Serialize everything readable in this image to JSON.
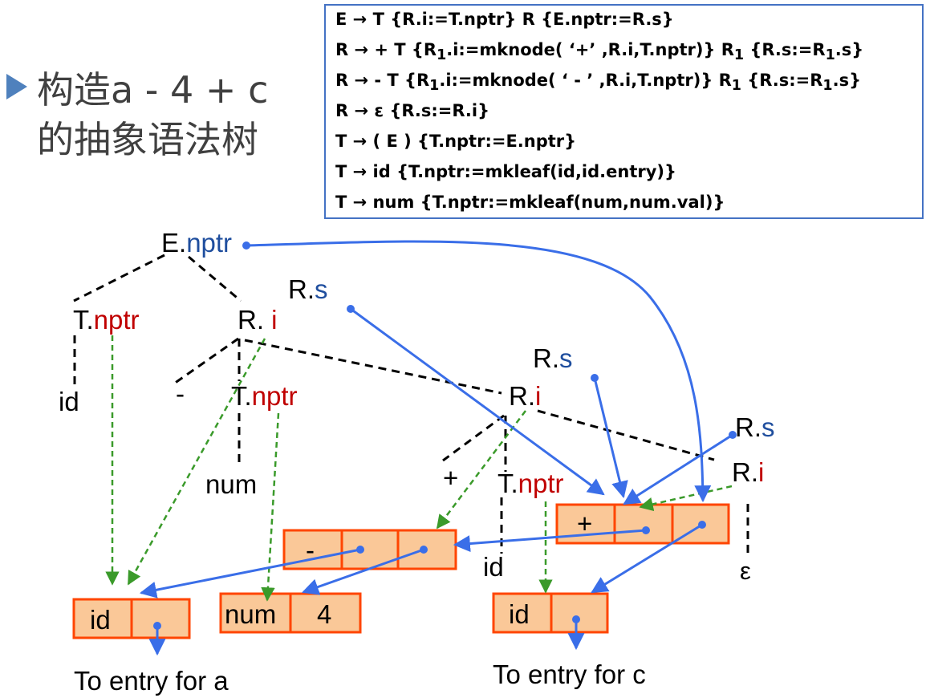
{
  "title": {
    "line1": "构造a - 4 + c",
    "line2": "的抽象语法树"
  },
  "grammar_rules": [
    [
      "E → T {R.i:=T.nptr}   R {E.nptr:=R.s}"
    ],
    [
      "R → +  T {R",
      "1",
      ".i:=mknode( ‘+’ ,R.i,T.nptr)} R",
      "1",
      " {R.s:=R",
      "1",
      ".s}"
    ],
    [
      "R → - T {R",
      "1",
      ".i:=mknode( ‘ - ’ ,R.i,T.nptr)} R",
      "1",
      " {R.s:=R",
      "1",
      ".s}"
    ],
    [
      "R → ε {R.s:=R.i}"
    ],
    [
      "T → ( E  ) {T.nptr:=E.nptr}"
    ],
    [
      "T → id {T.nptr:=mkleaf(id,id.entry)}"
    ],
    [
      "T → num {T.nptr:=mkleaf(num,num.val)}"
    ]
  ],
  "tree": {
    "E": {
      "base": "E.",
      "attr": "nptr"
    },
    "T1": {
      "base": "T.",
      "attr": "nptr"
    },
    "R1": {
      "base": "R. ",
      "attr": "i"
    },
    "R1s": {
      "base": "R.",
      "attr": "s"
    },
    "id1": "id",
    "minus": "-",
    "T2": {
      "base": "T.",
      "attr": "nptr"
    },
    "num": "num",
    "R2s": {
      "base": "R.",
      "attr": "s"
    },
    "R2": {
      "base": "R.",
      "attr": "i"
    },
    "plus": "+",
    "T3": {
      "base": "T.",
      "attr": "nptr"
    },
    "id2": "id",
    "R3s": {
      "base": "R.",
      "attr": "s"
    },
    "R3": {
      "base": "R.",
      "attr": "i"
    },
    "eps": "ε"
  },
  "nodes": {
    "id_a": [
      "id",
      ""
    ],
    "num4": [
      "num",
      "4"
    ],
    "minus_node": [
      "-",
      "",
      ""
    ],
    "plus_node": [
      "+",
      "",
      ""
    ],
    "id_c": [
      "id",
      ""
    ]
  },
  "captions": {
    "a": "To entry for a",
    "c": "To entry for c"
  },
  "colors": {
    "tree_edge": "#000000",
    "attr_red": "#c00000",
    "attr_blue": "#1f4e9e",
    "node_fill": "#fac898",
    "node_border": "#ff4500",
    "pointer_blue": "#3a6ee8",
    "flow_green": "#3a9a2a",
    "box_border": "#4472c4"
  }
}
